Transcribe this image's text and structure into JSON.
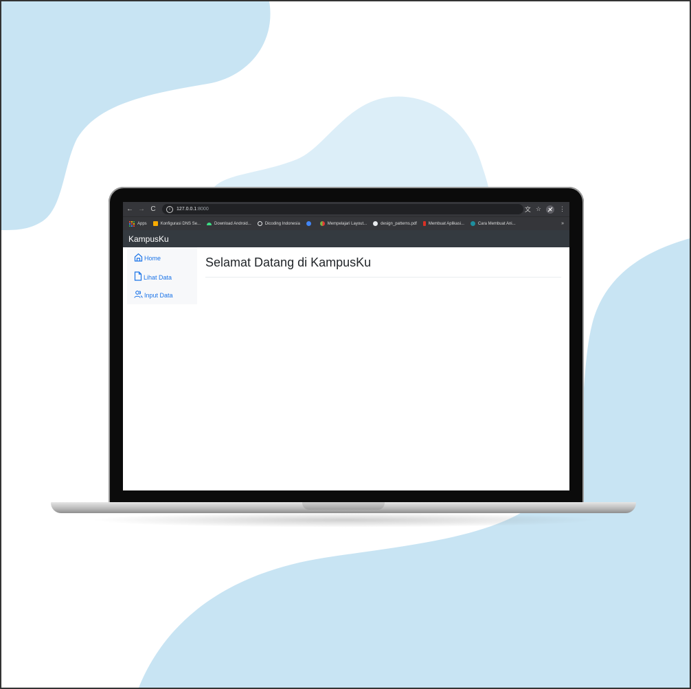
{
  "browser": {
    "url_host": "127.0.0.1",
    "url_port": ":8000",
    "back_glyph": "←",
    "forward_glyph": "→",
    "reload_glyph": "C",
    "info_glyph": "i",
    "translate_glyph": "文",
    "star_glyph": "☆",
    "menu_glyph": "⋮"
  },
  "bookmarks": {
    "items": [
      {
        "label": "Apps",
        "icon": "apps-grid-icon",
        "color": "#ea4335"
      },
      {
        "label": "Konfigurasi DNS Se...",
        "icon": "dns-icon",
        "color": "#f9ab00"
      },
      {
        "label": "Download Android...",
        "icon": "android-icon",
        "color": "#3ddc84"
      },
      {
        "label": "Dicoding Indonesia",
        "icon": "dicoding-icon",
        "color": "#e8eaed"
      },
      {
        "label": "",
        "icon": "wordpress-icon",
        "color": "#4285f4"
      },
      {
        "label": "Mempelajari Layout...",
        "icon": "layout-icon",
        "color": "#7cb342"
      },
      {
        "label": "design_patterns.pdf",
        "icon": "globe-icon",
        "color": "#e8eaed"
      },
      {
        "label": "Membuat Aplikasi...",
        "icon": "pdf-icon",
        "color": "#d93025"
      },
      {
        "label": "Cara Membuat Ani...",
        "icon": "circle-icon",
        "color": "#1e8e9e"
      }
    ],
    "more": "»"
  },
  "app": {
    "brand": "KampusKu",
    "nav_color": "#343a40",
    "link_color": "#1a73e8",
    "sidebar": [
      {
        "label": "Home",
        "icon": "home-icon"
      },
      {
        "label": "Lihat Data",
        "icon": "file-icon"
      },
      {
        "label": "Input Data",
        "icon": "users-icon"
      }
    ],
    "title": "Selamat Datang di KampusKu"
  }
}
